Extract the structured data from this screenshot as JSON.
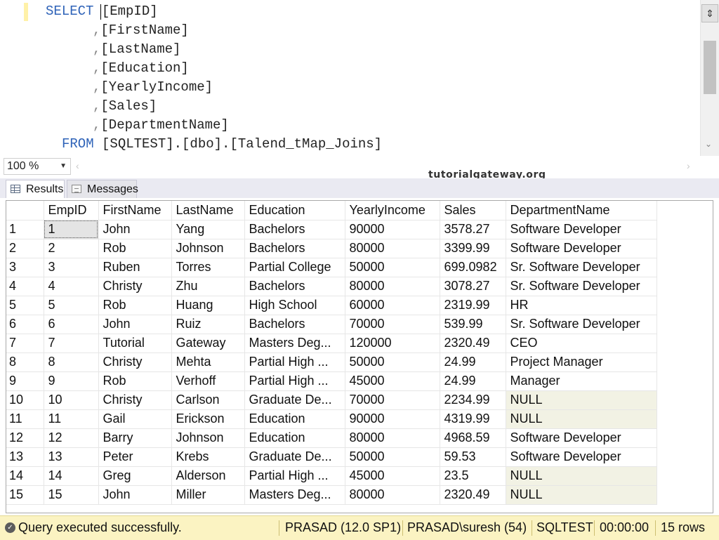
{
  "editor": {
    "lines": [
      {
        "kw": "SELECT ",
        "rest": "[EmpID]",
        "indent": "  "
      },
      {
        "kw": "",
        "rest": "[FirstName]",
        "indent": "           ,"
      },
      {
        "kw": "",
        "rest": "[LastName]",
        "indent": "           ,"
      },
      {
        "kw": "",
        "rest": "[Education]",
        "indent": "           ,"
      },
      {
        "kw": "",
        "rest": "[YearlyIncome]",
        "indent": "           ,"
      },
      {
        "kw": "",
        "rest": "[Sales]",
        "indent": "           ,"
      },
      {
        "kw": "",
        "rest": "[DepartmentName]",
        "indent": "           ,"
      },
      {
        "kw": "FROM ",
        "rest": "[SQLTEST].[dbo].[Talend_tMap_Joins]",
        "indent": "    "
      }
    ],
    "split_icon": "split-icon",
    "scroll_down_icon": "chevron-down-icon"
  },
  "zoom": {
    "value": "100 %"
  },
  "watermark": "tutorialgateway.org",
  "tabs": {
    "results": "Results",
    "messages": "Messages"
  },
  "grid": {
    "columns": [
      "",
      "EmpID",
      "FirstName",
      "LastName",
      "Education",
      "YearlyIncome",
      "Sales",
      "DepartmentName"
    ],
    "rows": [
      [
        "1",
        "1",
        "John",
        "Yang",
        "Bachelors",
        "90000",
        "3578.27",
        "Software Developer"
      ],
      [
        "2",
        "2",
        "Rob",
        "Johnson",
        "Bachelors",
        "80000",
        "3399.99",
        "Software Developer"
      ],
      [
        "3",
        "3",
        "Ruben",
        "Torres",
        "Partial College",
        "50000",
        "699.0982",
        "Sr. Software Developer"
      ],
      [
        "4",
        "4",
        "Christy",
        "Zhu",
        "Bachelors",
        "80000",
        "3078.27",
        "Sr. Software Developer"
      ],
      [
        "5",
        "5",
        "Rob",
        "Huang",
        "High School",
        "60000",
        "2319.99",
        "HR"
      ],
      [
        "6",
        "6",
        "John",
        "Ruiz",
        "Bachelors",
        "70000",
        "539.99",
        "Sr. Software Developer"
      ],
      [
        "7",
        "7",
        "Tutorial",
        "Gateway",
        "Masters Deg...",
        "120000",
        "2320.49",
        "CEO"
      ],
      [
        "8",
        "8",
        "Christy",
        "Mehta",
        "Partial High ...",
        "50000",
        "24.99",
        "Project Manager"
      ],
      [
        "9",
        "9",
        "Rob",
        "Verhoff",
        "Partial High ...",
        "45000",
        "24.99",
        "Manager"
      ],
      [
        "10",
        "10",
        "Christy",
        "Carlson",
        "Graduate De...",
        "70000",
        "2234.99",
        "NULL"
      ],
      [
        "11",
        "11",
        "Gail",
        "Erickson",
        "Education",
        "90000",
        "4319.99",
        "NULL"
      ],
      [
        "12",
        "12",
        "Barry",
        "Johnson",
        "Education",
        "80000",
        "4968.59",
        "Software Developer"
      ],
      [
        "13",
        "13",
        "Peter",
        "Krebs",
        "Graduate De...",
        "50000",
        "59.53",
        "Software Developer"
      ],
      [
        "14",
        "14",
        "Greg",
        "Alderson",
        "Partial High ...",
        "45000",
        "23.5",
        "NULL"
      ],
      [
        "15",
        "15",
        "John",
        "Miller",
        "Masters Deg...",
        "80000",
        "2320.49",
        "NULL"
      ]
    ]
  },
  "status": {
    "message": "Query executed successfully.",
    "server": "PRASAD (12.0 SP1)",
    "user": "PRASAD\\suresh (54)",
    "database": "SQLTEST",
    "elapsed": "00:00:00",
    "row_count": "15 rows",
    "colors": {
      "background": "#fbf3c2",
      "null_cell": "#f2f2e4",
      "keyword": "#2f63b8"
    }
  }
}
